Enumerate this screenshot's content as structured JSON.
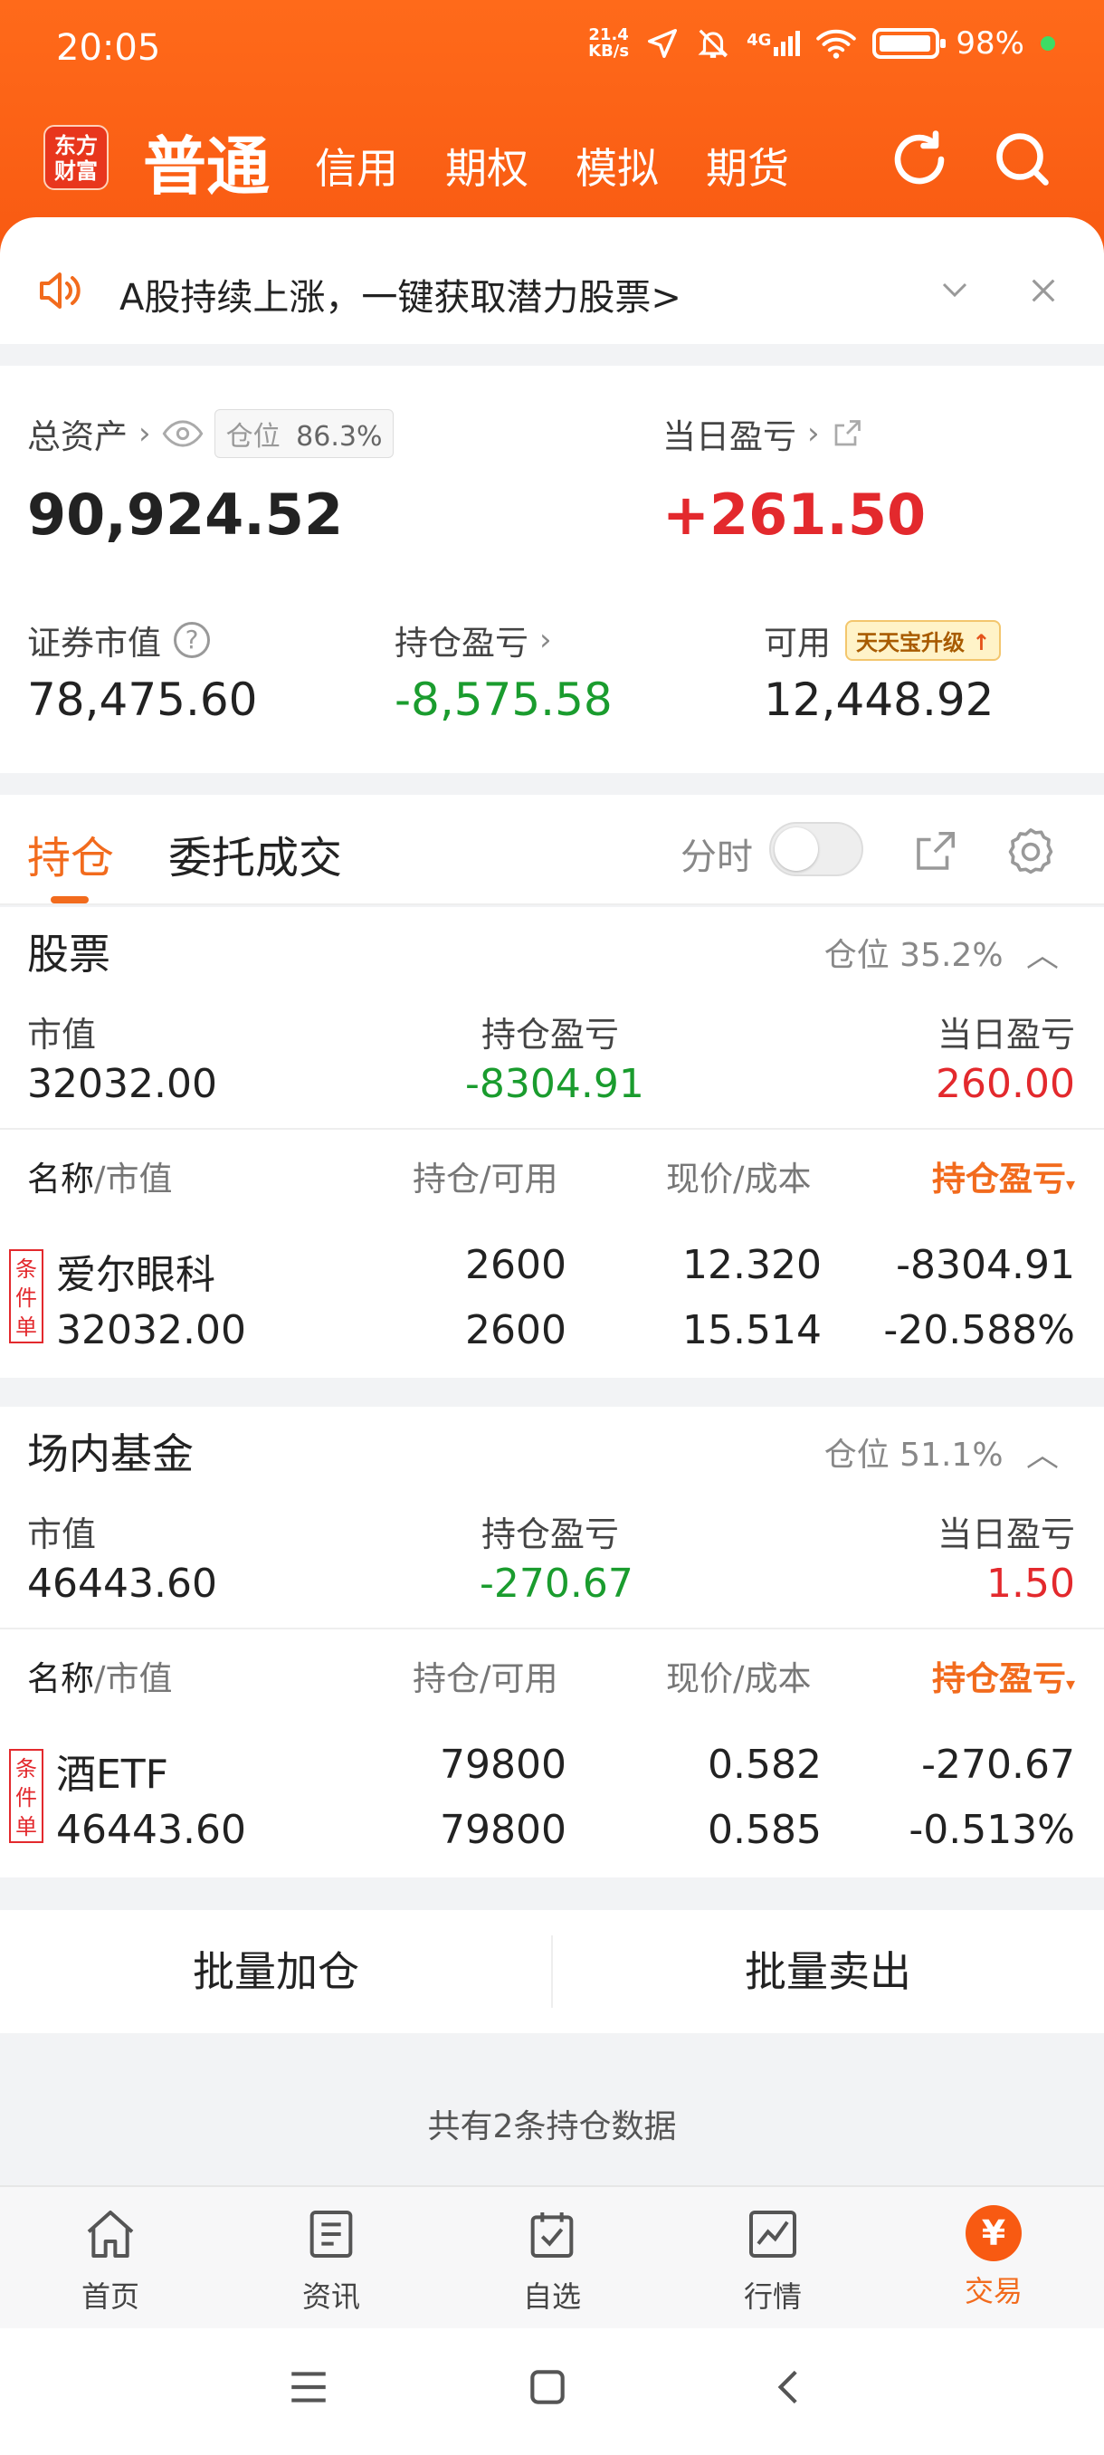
{
  "status_bar": {
    "time": "20:05",
    "net_speed_value": "21.4",
    "net_speed_unit": "KB/s",
    "signal_label": "4G",
    "battery": "98%"
  },
  "header": {
    "logo_line1": "东方",
    "logo_line2": "财富",
    "tabs": [
      "普通",
      "信用",
      "期权",
      "模拟",
      "期货"
    ],
    "active_tab": "普通"
  },
  "banner": {
    "text": "A股持续上涨，一键获取潜力股票>"
  },
  "assets": {
    "total_label": "总资产",
    "position_label": "仓位",
    "position_value": "86.3%",
    "total_value": "90,924.52",
    "daily_pl_label": "当日盈亏",
    "daily_pl_value": "+261.50",
    "market_value_label": "证券市值",
    "market_value": "78,475.60",
    "holding_pl_label": "持仓盈亏",
    "holding_pl_value": "-8,575.58",
    "available_label": "可用",
    "upgrade_tag": "天天宝升级",
    "available_value": "12,448.92"
  },
  "holdings_tabs": {
    "tab1": "持仓",
    "tab2": "委托成交",
    "fenshi": "分时"
  },
  "stocks": {
    "title": "股票",
    "position": "仓位 35.2%",
    "summary_labels": [
      "市值",
      "持仓盈亏",
      "当日盈亏"
    ],
    "market_value": "32032.00",
    "holding_pl": "-8304.91",
    "daily_pl": "260.00",
    "headers": {
      "name_a": "名称",
      "name_b": "/市值",
      "qty": "持仓/可用",
      "price": "现价/成本",
      "pl": "持仓盈亏"
    },
    "rows": [
      {
        "tag": "条件单",
        "name": "爱尔眼科",
        "value": "32032.00",
        "holding": "2600",
        "available": "2600",
        "price": "12.320",
        "cost": "15.514",
        "pl": "-8304.91",
        "pl_pct": "-20.588%"
      }
    ]
  },
  "funds": {
    "title": "场内基金",
    "position": "仓位 51.1%",
    "summary_labels": [
      "市值",
      "持仓盈亏",
      "当日盈亏"
    ],
    "market_value": "46443.60",
    "holding_pl": "-270.67",
    "daily_pl": "1.50",
    "headers": {
      "name_a": "名称",
      "name_b": "/市值",
      "qty": "持仓/可用",
      "price": "现价/成本",
      "pl": "持仓盈亏"
    },
    "rows": [
      {
        "tag": "条件单",
        "name": "酒ETF",
        "value": "46443.60",
        "holding": "79800",
        "available": "79800",
        "price": "0.582",
        "cost": "0.585",
        "pl": "-270.67",
        "pl_pct": "-0.513%"
      }
    ]
  },
  "batch": {
    "add": "批量加仓",
    "sell": "批量卖出"
  },
  "total_text": "共有2条持仓数据",
  "bottom_nav": [
    "首页",
    "资讯",
    "自选",
    "行情",
    "交易"
  ],
  "trade_icon_char": "¥",
  "colors": {
    "brand_orange": "#f85a12",
    "up_red": "#e3292d",
    "down_green": "#1a9c2e"
  }
}
